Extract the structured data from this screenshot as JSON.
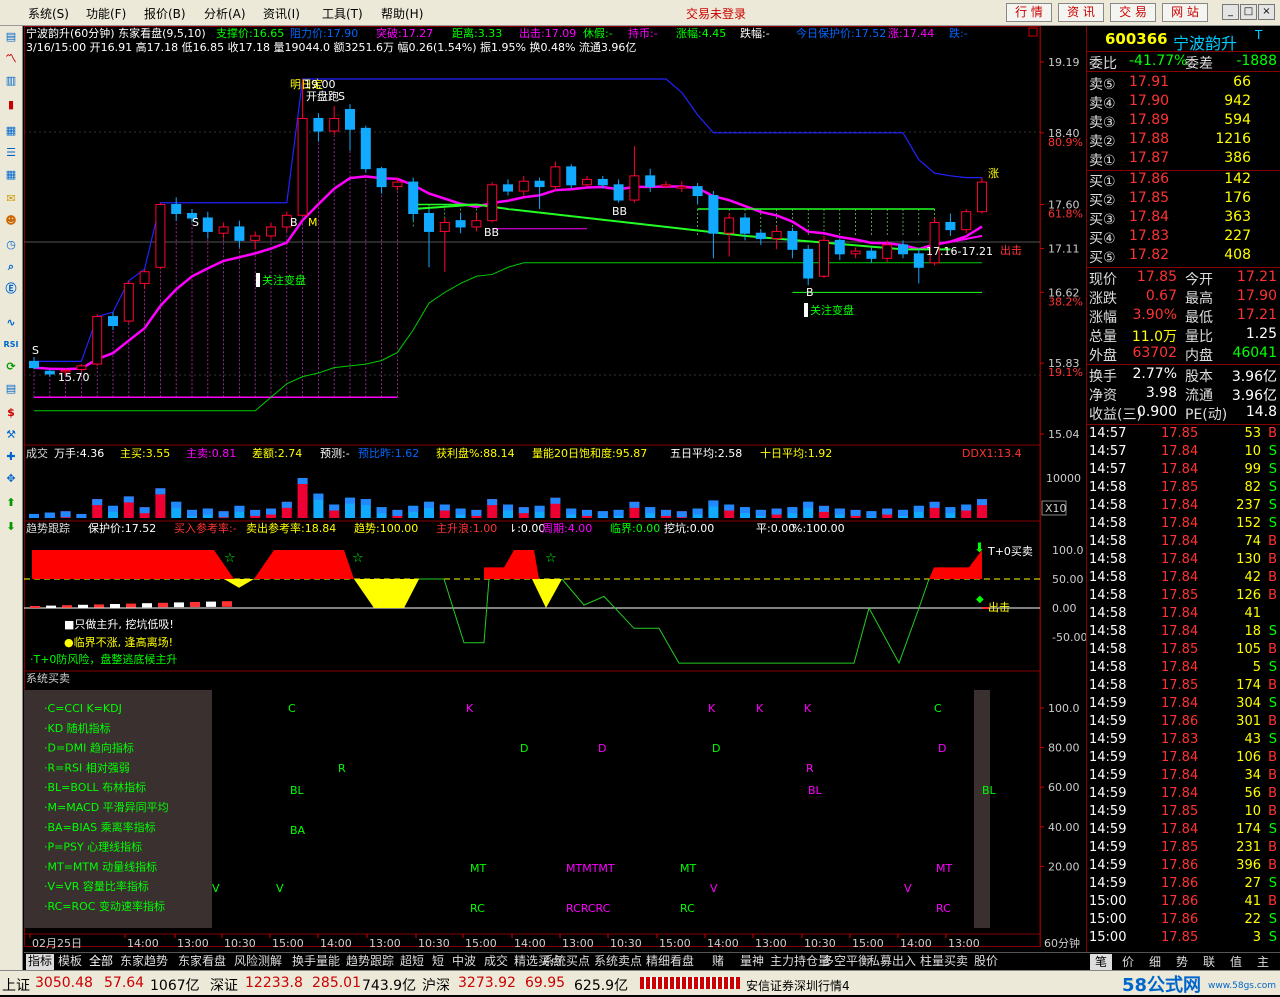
{
  "menu": {
    "items": [
      "系统(S)",
      "功能(F)",
      "报价(B)",
      "分析(A)",
      "资讯(I)",
      "工具(T)",
      "帮助(H)"
    ],
    "trade_status": "交易未登录",
    "buttons": [
      "行 情",
      "资 讯",
      "交 易",
      "网 站"
    ],
    "window_buttons": [
      "_",
      "□",
      "×"
    ]
  },
  "left_toolbar": {
    "icons": [
      "k-chart-icon",
      "line-chart-icon",
      "bar-chart-icon",
      "window-icon",
      "list-icon",
      "table-icon",
      "mail-icon",
      "people-icon",
      "clock-icon",
      "search-icon",
      "finance-icon",
      "wave-icon",
      "rsi-icon",
      "refresh-icon",
      "dollar-icon",
      "tools-icon",
      "plus-icon",
      "move-icon",
      "up-arrow-icon",
      "down-arrow-icon"
    ]
  },
  "chart_header": {
    "title": "宁波韵升(60分钟) 东家看盘(9,5,10)",
    "items": [
      {
        "label": "支撑价:16.65",
        "color": "#00ff00"
      },
      {
        "label": "阻力价:17.90",
        "color": "#0066ff"
      },
      {
        "label": "突破:17.27",
        "color": "#ff00ff"
      },
      {
        "label": "距离:3.33",
        "color": "#00ff00"
      },
      {
        "label": "出击:17.09",
        "color": "#ff00ff"
      },
      {
        "label": "休假:-",
        "color": "#00ff00"
      },
      {
        "label": "持币:-",
        "color": "#ff00ff"
      },
      {
        "label": "涨幅:4.45",
        "color": "#00ff00"
      },
      {
        "label": "跌幅:-",
        "color": "#ffffff"
      },
      {
        "label": "今日保护价:17.52",
        "color": "#0066ff"
      },
      {
        "label": "涨:17.44",
        "color": "#ff00ff"
      },
      {
        "label": "跌:-",
        "color": "#0066ff"
      }
    ],
    "line2": "3/16/15:00 开16.91 高17.18 低16.85 收17.18 量19044.0 额3251.6万 幅0.26(1.54%) 振1.95% 换0.48% 流通3.96亿"
  },
  "price_axis": {
    "labels": [
      "19.19",
      "18.40",
      "80.9%",
      "17.60",
      "61.8%",
      "17.11",
      "16.62",
      "38.2%",
      "15.83",
      "19.1%",
      "15.04"
    ]
  },
  "chart_annotations": {
    "texts": [
      "明日定",
      "19.00",
      "开盘跑",
      "S",
      "B",
      "M",
      "S",
      "BB",
      "BB",
      "关注变盘",
      "关注变盘",
      "B",
      "15.70",
      "17.16-17.21",
      "出击",
      "涨"
    ]
  },
  "volume_panel": {
    "items": [
      {
        "label": "成交",
        "color": "#dddddd"
      },
      {
        "label": "万手:4.36",
        "color": "#ffffff"
      },
      {
        "label": "主买:3.55",
        "color": "#ffff00"
      },
      {
        "label": "主卖:0.81",
        "color": "#ff00ff"
      },
      {
        "label": "差额:2.74",
        "color": "#ffff00"
      },
      {
        "label": "预测:-",
        "color": "#ffffff"
      },
      {
        "label": "预比昨:1.62",
        "color": "#0066ff"
      },
      {
        "label": "获利盘%:88.14",
        "color": "#ffff00"
      },
      {
        "label": "量能20日饱和度:95.87",
        "color": "#ffff00"
      },
      {
        "label": "五日平均:2.58",
        "color": "#ffffff"
      },
      {
        "label": "十日平均:1.92",
        "color": "#ffff00"
      },
      {
        "label": "DDX1:13.4",
        "color": "#ff3333"
      }
    ],
    "axis": [
      "10000",
      "X10"
    ]
  },
  "trend_panel": {
    "items": [
      {
        "label": "趋势跟踪",
        "color": "#dddddd"
      },
      {
        "label": "保护价:17.52",
        "color": "#ffffff"
      },
      {
        "label": "买入参考率:-",
        "color": "#ff3333"
      },
      {
        "label": "卖出参考率:18.84",
        "color": "#ffff00"
      },
      {
        "label": "趋势:100.00",
        "color": "#ffff00"
      },
      {
        "label": "主升浪:1.00",
        "color": "#ff3333"
      },
      {
        "label": "⇂:0.00",
        "color": "#ffffff"
      },
      {
        "label": "周期:4.00",
        "color": "#ff00ff"
      },
      {
        "label": "临界:0.00",
        "color": "#00ff00"
      },
      {
        "label": "挖坑:0.00",
        "color": "#ffffff"
      },
      {
        "label": "平:0.00",
        "color": "#ffffff"
      },
      {
        "label": "%:100.00",
        "color": "#ffffff"
      }
    ],
    "axis": [
      "100.0",
      "50.00",
      "0.00",
      "-50.00"
    ],
    "notes": [
      "■只做主升, 挖坑低吸!",
      "●临界不涨, 逢高离场!",
      "·T+0防风险，盘整逃底候主升"
    ],
    "buy_label": "T+0买卖",
    "sell_label": "出击"
  },
  "signal_panel": {
    "title": "系统买卖",
    "legend": [
      "·C=CCI   K=KDJ",
      "·KD  随机指标",
      "·D=DMI  趋向指标",
      "·R=RSI  相对强弱",
      "·BL=BOLL  布林指标",
      "·M=MACD  平滑异同平均",
      "·BA=BIAS  乘离率指标",
      "·P=PSY   心理线指标",
      "·MT=MTM  动量线指标",
      "·V=VR  容量比率指标",
      "·RC=ROC  变动速率指标"
    ],
    "axis": [
      "100.0",
      "80.00",
      "60.00",
      "40.00",
      "20.00"
    ]
  },
  "time_axis": {
    "labels": [
      "02月25日",
      "14:00",
      "13:00",
      "10:30",
      "15:00",
      "14:00",
      "13:00",
      "10:30",
      "15:00",
      "14:00",
      "13:00",
      "10:30",
      "15:00",
      "14:00",
      "13:00",
      "10:30",
      "15:00",
      "14:00",
      "13:00"
    ],
    "period": "60分钟"
  },
  "bottom_tabs": [
    "指标",
    "模板",
    "全部",
    "东家趋势",
    "东家看盘",
    "风险测解",
    "换手量能",
    "趋势跟踪",
    "超短",
    "短",
    "中波",
    "成交",
    "精选买点",
    "系统买点",
    "系统卖点",
    "精细看盘",
    "赌",
    "量神",
    "主力持仓量",
    "多空平衡",
    "私募出入",
    "柱量买卖",
    "股价"
  ],
  "right_panel": {
    "code": "600366",
    "name": "宁波韵升",
    "tag": "T",
    "weibi_label": "委比",
    "weibi": "-41.77%",
    "weicha_label": "委差",
    "weicha": "-1888",
    "asks": [
      {
        "label": "卖⑤",
        "price": "17.91",
        "vol": "66"
      },
      {
        "label": "卖④",
        "price": "17.90",
        "vol": "942"
      },
      {
        "label": "卖③",
        "price": "17.89",
        "vol": "594"
      },
      {
        "label": "卖②",
        "price": "17.88",
        "vol": "1216"
      },
      {
        "label": "卖①",
        "price": "17.87",
        "vol": "386"
      }
    ],
    "bids": [
      {
        "label": "买①",
        "price": "17.86",
        "vol": "142"
      },
      {
        "label": "买②",
        "price": "17.85",
        "vol": "176"
      },
      {
        "label": "买③",
        "price": "17.84",
        "vol": "363"
      },
      {
        "label": "买④",
        "price": "17.83",
        "vol": "227"
      },
      {
        "label": "买⑤",
        "price": "17.82",
        "vol": "408"
      }
    ],
    "quote": [
      {
        "l1": "现价",
        "v1": "17.85",
        "c1": "#ff3333",
        "l2": "今开",
        "v2": "17.21",
        "c2": "#ff3333"
      },
      {
        "l1": "涨跌",
        "v1": "0.67",
        "c1": "#ff3333",
        "l2": "最高",
        "v2": "17.90",
        "c2": "#ff3333"
      },
      {
        "l1": "涨幅",
        "v1": "3.90%",
        "c1": "#ff3333",
        "l2": "最低",
        "v2": "17.21",
        "c2": "#ff3333"
      },
      {
        "l1": "总量",
        "v1": "11.0万",
        "c1": "#ffff00",
        "l2": "量比",
        "v2": "1.25",
        "c2": "#ffffff"
      },
      {
        "l1": "外盘",
        "v1": "63702",
        "c1": "#ff3333",
        "l2": "内盘",
        "v2": "46041",
        "c2": "#00ff00"
      }
    ],
    "quote2": [
      {
        "l1": "换手",
        "v1": "2.77%",
        "l2": "股本",
        "v2": "3.96亿"
      },
      {
        "l1": "净资",
        "v1": "3.98",
        "l2": "流通",
        "v2": "3.96亿"
      },
      {
        "l1": "收益(三)",
        "v1": "0.900",
        "l2": "PE(动)",
        "v2": "14.8"
      }
    ],
    "ticks": [
      {
        "t": "14:57",
        "p": "17.85",
        "v": "53",
        "s": "B"
      },
      {
        "t": "14:57",
        "p": "17.84",
        "v": "10",
        "s": "S"
      },
      {
        "t": "14:57",
        "p": "17.84",
        "v": "99",
        "s": "S"
      },
      {
        "t": "14:58",
        "p": "17.85",
        "v": "82",
        "s": "S"
      },
      {
        "t": "14:58",
        "p": "17.84",
        "v": "237",
        "s": "S"
      },
      {
        "t": "14:58",
        "p": "17.84",
        "v": "152",
        "s": "S"
      },
      {
        "t": "14:58",
        "p": "17.84",
        "v": "74",
        "s": "B"
      },
      {
        "t": "14:58",
        "p": "17.84",
        "v": "130",
        "s": "B"
      },
      {
        "t": "14:58",
        "p": "17.84",
        "v": "42",
        "s": "B"
      },
      {
        "t": "14:58",
        "p": "17.85",
        "v": "126",
        "s": "B"
      },
      {
        "t": "14:58",
        "p": "17.84",
        "v": "41",
        "s": ""
      },
      {
        "t": "14:58",
        "p": "17.84",
        "v": "18",
        "s": "S"
      },
      {
        "t": "14:58",
        "p": "17.85",
        "v": "105",
        "s": "B"
      },
      {
        "t": "14:58",
        "p": "17.84",
        "v": "5",
        "s": "S"
      },
      {
        "t": "14:58",
        "p": "17.85",
        "v": "174",
        "s": "B"
      },
      {
        "t": "14:59",
        "p": "17.84",
        "v": "304",
        "s": "S"
      },
      {
        "t": "14:59",
        "p": "17.86",
        "v": "301",
        "s": "B"
      },
      {
        "t": "14:59",
        "p": "17.83",
        "v": "43",
        "s": "S"
      },
      {
        "t": "14:59",
        "p": "17.84",
        "v": "106",
        "s": "B"
      },
      {
        "t": "14:59",
        "p": "17.84",
        "v": "34",
        "s": "B"
      },
      {
        "t": "14:59",
        "p": "17.84",
        "v": "56",
        "s": "B"
      },
      {
        "t": "14:59",
        "p": "17.85",
        "v": "10",
        "s": "B"
      },
      {
        "t": "14:59",
        "p": "17.84",
        "v": "174",
        "s": "S"
      },
      {
        "t": "14:59",
        "p": "17.85",
        "v": "231",
        "s": "B"
      },
      {
        "t": "14:59",
        "p": "17.86",
        "v": "396",
        "s": "B"
      },
      {
        "t": "14:59",
        "p": "17.86",
        "v": "27",
        "s": "S"
      },
      {
        "t": "15:00",
        "p": "17.86",
        "v": "41",
        "s": "B"
      },
      {
        "t": "15:00",
        "p": "17.86",
        "v": "22",
        "s": "S"
      },
      {
        "t": "15:00",
        "p": "17.85",
        "v": "3",
        "s": "S"
      }
    ],
    "tabs": [
      "笔",
      "价",
      "细",
      "势",
      "联",
      "值",
      "主"
    ]
  },
  "status_bar": {
    "sh_label": "上证",
    "sh_val": "3050.48",
    "sh_chg": "57.64",
    "sh_amt": "1067亿",
    "sz_label": "深证",
    "sz_val": "12233.8",
    "sz_chg": "285.01",
    "sz_amt": "743.9亿",
    "hs_label": "沪深",
    "hs_val": "3273.92",
    "hs_chg": "69.95",
    "hs_amt": "625.9亿",
    "broker": "安信证券深圳行情4",
    "watermark": "58公式网",
    "watermark_url": "www.58gs.com"
  },
  "chart_data": {
    "type": "candlestick",
    "candles": [
      [
        15.85,
        15.78,
        15.9,
        15.76
      ],
      [
        15.74,
        15.71,
        15.76,
        15.68
      ],
      [
        15.74,
        15.75,
        15.77,
        15.7
      ],
      [
        15.76,
        15.8,
        15.82,
        15.74
      ],
      [
        15.82,
        16.35,
        16.38,
        15.8
      ],
      [
        16.35,
        16.25,
        16.4,
        16.2
      ],
      [
        16.3,
        16.72,
        16.75,
        16.28
      ],
      [
        16.72,
        16.85,
        16.88,
        16.66
      ],
      [
        16.9,
        17.6,
        17.62,
        16.88
      ],
      [
        17.6,
        17.5,
        17.68,
        17.42
      ],
      [
        17.5,
        17.45,
        17.55,
        17.4
      ],
      [
        17.45,
        17.3,
        17.52,
        17.22
      ],
      [
        17.28,
        17.35,
        17.4,
        17.22
      ],
      [
        17.35,
        17.2,
        17.42,
        17.12
      ],
      [
        17.2,
        17.25,
        17.3,
        17.1
      ],
      [
        17.25,
        17.35,
        17.4,
        17.22
      ],
      [
        17.35,
        17.48,
        17.52,
        17.3
      ],
      [
        17.48,
        18.56,
        19.0,
        17.48
      ],
      [
        18.56,
        18.42,
        18.62,
        18.3
      ],
      [
        18.42,
        18.56,
        18.7,
        18.38
      ],
      [
        18.66,
        18.44,
        18.72,
        18.2
      ],
      [
        18.45,
        18.0,
        18.48,
        17.96
      ],
      [
        18.0,
        17.8,
        18.02,
        17.72
      ],
      [
        17.8,
        17.85,
        17.9,
        17.76
      ],
      [
        17.85,
        17.5,
        17.9,
        17.42
      ],
      [
        17.5,
        17.3,
        17.55,
        16.9
      ],
      [
        17.3,
        17.4,
        17.45,
        16.85
      ],
      [
        17.42,
        17.35,
        17.5,
        17.28
      ],
      [
        17.35,
        17.42,
        17.5,
        17.3
      ],
      [
        17.42,
        17.82,
        17.85,
        17.4
      ],
      [
        17.82,
        17.75,
        17.88,
        17.7
      ],
      [
        17.75,
        17.86,
        17.92,
        17.7
      ],
      [
        17.86,
        17.8,
        17.9,
        17.55
      ],
      [
        17.8,
        18.02,
        18.08,
        17.75
      ],
      [
        18.02,
        17.82,
        18.05,
        17.78
      ],
      [
        17.82,
        17.88,
        17.92,
        17.8
      ],
      [
        17.88,
        17.82,
        17.92,
        17.78
      ],
      [
        17.82,
        17.65,
        17.88,
        17.62
      ],
      [
        17.65,
        17.92,
        18.25,
        17.62
      ],
      [
        17.92,
        17.8,
        18.0,
        17.74
      ],
      [
        17.82,
        17.82,
        17.86,
        17.78
      ],
      [
        17.8,
        17.8,
        17.86,
        17.74
      ],
      [
        17.8,
        17.7,
        17.84,
        17.6
      ],
      [
        17.7,
        17.28,
        17.75,
        17.0
      ],
      [
        17.28,
        17.45,
        17.5,
        17.02
      ],
      [
        17.45,
        17.28,
        17.5,
        17.2
      ],
      [
        17.28,
        17.22,
        17.32,
        17.15
      ],
      [
        17.22,
        17.3,
        17.36,
        17.1
      ],
      [
        17.3,
        17.1,
        17.34,
        17.0
      ],
      [
        17.1,
        16.78,
        17.15,
        16.7
      ],
      [
        16.8,
        17.2,
        17.25,
        16.78
      ],
      [
        17.2,
        17.05,
        17.22,
        16.98
      ],
      [
        17.05,
        17.08,
        17.12,
        17.0
      ],
      [
        17.08,
        17.0,
        17.12,
        16.95
      ],
      [
        17.0,
        17.15,
        17.2,
        16.96
      ],
      [
        17.15,
        17.05,
        17.2,
        17.0
      ],
      [
        17.05,
        16.9,
        17.1,
        16.72
      ],
      [
        16.95,
        17.4,
        17.45,
        16.92
      ],
      [
        17.4,
        17.32,
        17.5,
        17.25
      ],
      [
        17.32,
        17.52,
        17.55,
        17.28
      ],
      [
        17.52,
        17.85,
        17.9,
        17.5
      ]
    ],
    "ylim": [
      15.04,
      19.19
    ]
  }
}
